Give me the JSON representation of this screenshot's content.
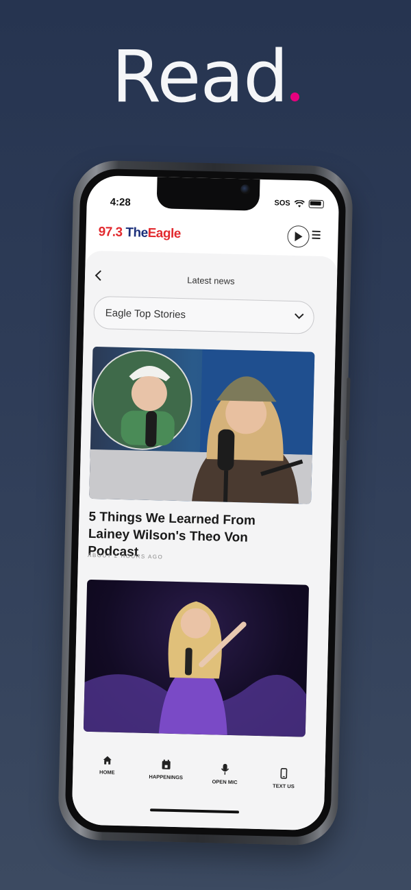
{
  "promo": {
    "headline": "Read",
    "accent_color": "#e6007e"
  },
  "status_bar": {
    "time": "4:28",
    "carrier": "SOS"
  },
  "app_header": {
    "logo": {
      "number": "97.3",
      "the": "The",
      "name": "Eagle"
    },
    "play_icon": "play-icon",
    "menu_icon": "menu-icon"
  },
  "page": {
    "title": "Latest news",
    "back_icon": "chevron-left-icon",
    "category_select": {
      "selected": "Eagle Top Stories",
      "icon": "chevron-down-icon"
    }
  },
  "stories": [
    {
      "title": "5 Things We Learned From Lainey Wilson's Theo Von Podcast",
      "time": "ABOUT 2 HOURS AGO"
    }
  ],
  "tabbar": {
    "items": [
      {
        "label": "HOME",
        "icon": "home-icon"
      },
      {
        "label": "HAPPENINGS",
        "icon": "calendar-icon"
      },
      {
        "label": "OPEN MIC",
        "icon": "microphone-icon"
      },
      {
        "label": "TEXT US",
        "icon": "phone-icon"
      }
    ]
  }
}
